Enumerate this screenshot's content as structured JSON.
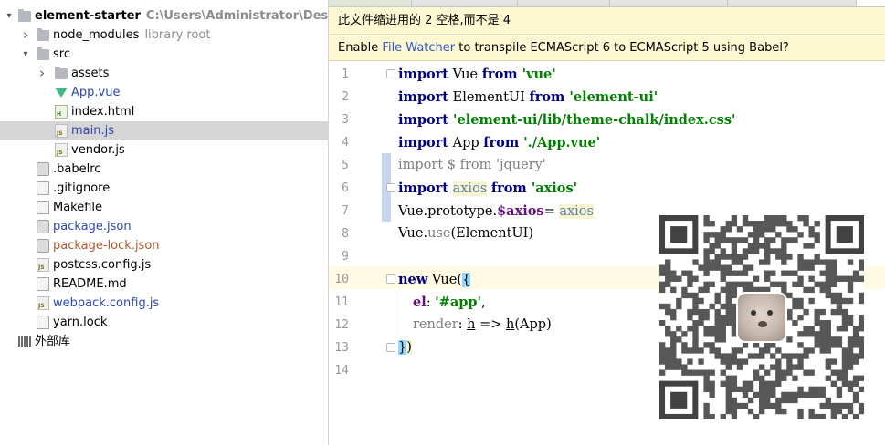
{
  "project": {
    "name": "element-starter",
    "path": "C:\\Users\\Administrator\\Desktop\\elem"
  },
  "tree": [
    {
      "label": "element-starter",
      "extra": "C:\\Users\\Administrator\\Desktop\\elem",
      "icon": "folder-icon",
      "arrow": "expanded"
    },
    {
      "label": "node_modules",
      "extra": "library root",
      "icon": "folder-icon",
      "arrow": "collapsed"
    },
    {
      "label": "src",
      "extra": "",
      "icon": "folder-icon",
      "arrow": "expanded"
    },
    {
      "label": "assets",
      "extra": "",
      "icon": "folder-icon",
      "arrow": "collapsed"
    },
    {
      "label": "App.vue",
      "extra": "",
      "icon": "vue-file-icon"
    },
    {
      "label": "index.html",
      "extra": "",
      "icon": "html-file-icon"
    },
    {
      "label": "main.js",
      "extra": "",
      "icon": "js-file-icon",
      "selected": true
    },
    {
      "label": "vendor.js",
      "extra": "",
      "icon": "js-file-icon"
    },
    {
      "label": ".babelrc",
      "extra": "",
      "icon": "config-file-icon"
    },
    {
      "label": ".gitignore",
      "extra": "",
      "icon": "text-file-icon"
    },
    {
      "label": "Makefile",
      "extra": "",
      "icon": "text-file-icon"
    },
    {
      "label": "package.json",
      "extra": "",
      "icon": "config-file-icon"
    },
    {
      "label": "package-lock.json",
      "extra": "",
      "icon": "config-file-icon"
    },
    {
      "label": "postcss.config.js",
      "extra": "",
      "icon": "js-file-icon"
    },
    {
      "label": "README.md",
      "extra": "",
      "icon": "text-file-icon"
    },
    {
      "label": "webpack.config.js",
      "extra": "",
      "icon": "js-file-icon"
    },
    {
      "label": "yarn.lock",
      "extra": "",
      "icon": "text-file-icon"
    },
    {
      "label": "外部库",
      "extra": "",
      "icon": "external-libraries-icon"
    }
  ],
  "banners": {
    "indent_notice": "此文件缩进用的 2 空格,而不是 4",
    "watcher_prefix": "Enable ",
    "watcher_link": "File Watcher",
    "watcher_suffix": " to transpile ECMAScript 6 to ECMAScript 5 using Babel?"
  },
  "editor": {
    "line_numbers": [
      "1",
      "2",
      "3",
      "4",
      "5",
      "6",
      "7",
      "8",
      "9",
      "10",
      "11",
      "12",
      "13",
      "14"
    ],
    "lines": {
      "l1_kw": "import",
      "l1_id": " Vue ",
      "l1_from": "from",
      "l1_str": " 'vue'",
      "l2_kw": "import",
      "l2_id": " ElementUI ",
      "l2_from": "from",
      "l2_str": " 'element-ui'",
      "l3_kw": "import",
      "l3_str": " 'element-ui/lib/theme-chalk/index.css'",
      "l4_kw": "import",
      "l4_id": " App ",
      "l4_from": "from",
      "l4_str": " './App.vue'",
      "l5_text": "import $ from 'jquery'",
      "l6_kw": "import",
      "l6_id": "axios",
      "l6_from": "from",
      "l6_str": " 'axios'",
      "l7_a": "Vue.prototype.",
      "l7_prop": "$axios",
      "l7_b": "= ",
      "l7_c": "axios",
      "l8_a": "Vue.",
      "l8_fn": "use",
      "l8_b": "(ElementUI)",
      "l10_kw": "new",
      "l10_a": " Vue(",
      "l10_brace": "{",
      "l11_key": "el",
      "l11_colon": ": ",
      "l11_str": "'#app'",
      "l11_comma": ",",
      "l12_key": "render",
      "l12_a": ": ",
      "l12_h1": "h",
      "l12_b": " => ",
      "l12_h2": "h",
      "l12_c": "(App)",
      "l13_brace": "}",
      "l13_paren": ")"
    }
  },
  "colors": {
    "keyword": "#000080",
    "string": "#008000",
    "banner_bg": "#fdf7d2",
    "selected_row": "#d5d5d5",
    "link": "#2f56c7"
  }
}
